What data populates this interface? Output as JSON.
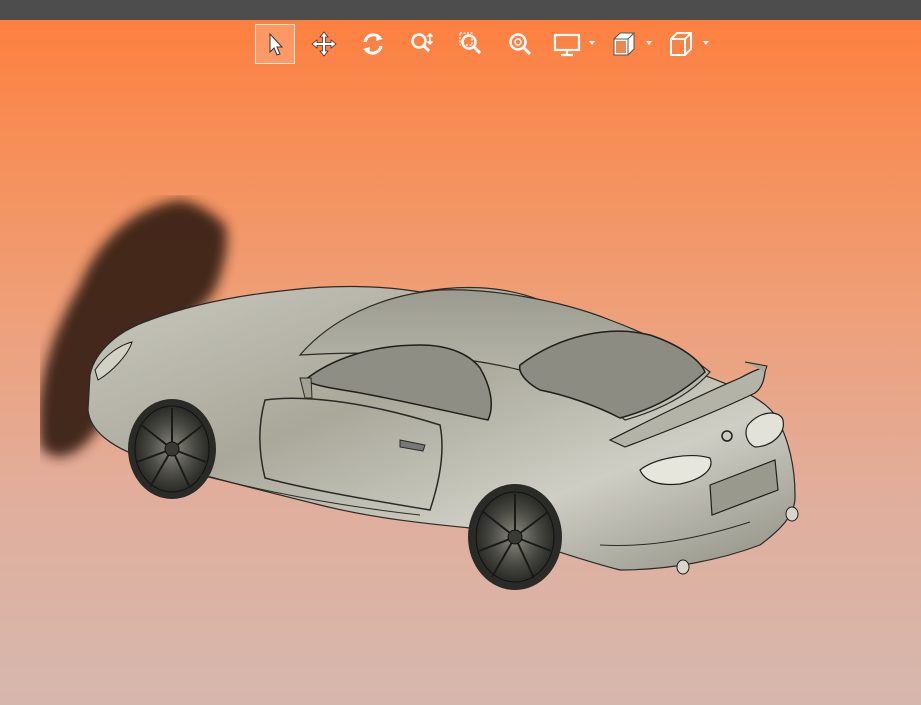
{
  "app": {
    "titlebar_color": "#4d4d4d",
    "background_top": "#ff7d3c",
    "background_bottom": "#d6b7ad"
  },
  "toolbar": {
    "buttons": [
      {
        "name": "select-tool",
        "icon": "cursor-arrow-icon",
        "active": true
      },
      {
        "name": "pan-tool",
        "icon": "move-arrows-icon"
      },
      {
        "name": "rotate-tool",
        "icon": "rotate-icon"
      },
      {
        "name": "zoom-tool",
        "icon": "zoom-updown-icon"
      },
      {
        "name": "zoom-window-tool",
        "icon": "zoom-window-icon"
      },
      {
        "name": "zoom-fit-tool",
        "icon": "zoom-fit-icon"
      },
      {
        "name": "display-mode-menu",
        "icon": "monitor-icon",
        "dropdown": true
      },
      {
        "name": "section-view-menu",
        "icon": "section-cube-icon",
        "dropdown": true
      },
      {
        "name": "view-orientation-menu",
        "icon": "cube-icon",
        "dropdown": true
      }
    ]
  },
  "viewport": {
    "model": "sports-car-3d-model",
    "model_color": "#b9b8ab",
    "shadow_color": "#3a2418"
  }
}
